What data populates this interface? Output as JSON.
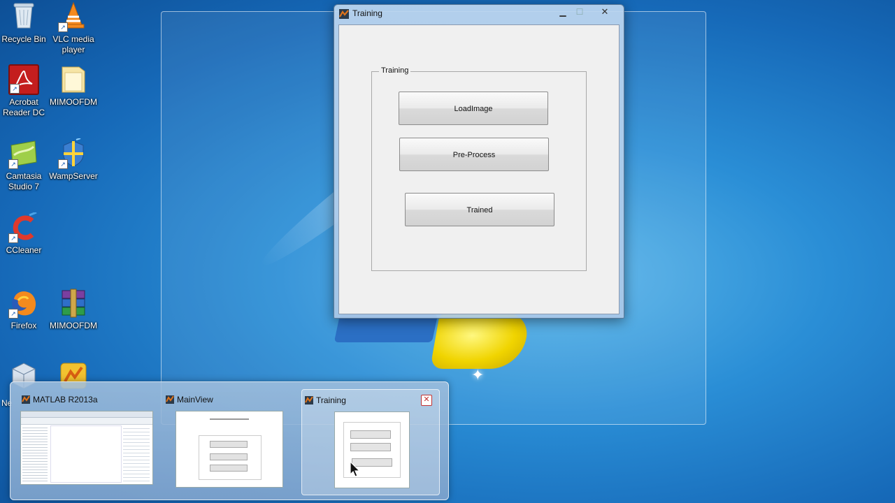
{
  "desktop": {
    "icons": [
      {
        "label": "Recycle Bin",
        "icon": "recycle-bin-icon"
      },
      {
        "label": "VLC media player",
        "icon": "vlc-icon"
      },
      {
        "label": "Acrobat Reader DC",
        "icon": "acrobat-icon"
      },
      {
        "label": "MIMOOFDM",
        "icon": "folder-icon"
      },
      {
        "label": "Camtasia Studio 7",
        "icon": "camtasia-icon"
      },
      {
        "label": "WampServer",
        "icon": "wampserver-icon"
      },
      {
        "label": "CCleaner",
        "icon": "ccleaner-icon"
      },
      {
        "label": "Firefox",
        "icon": "firefox-icon"
      },
      {
        "label": "MIMOOFDM",
        "icon": "winrar-archive-icon"
      }
    ],
    "partial_label": "Ne"
  },
  "window": {
    "title": "Training",
    "controls": {
      "minimize": "▁",
      "maximize": "☐",
      "close": "✕"
    },
    "panel": {
      "title": "Training",
      "buttons": {
        "load": "LoadImage",
        "preprocess": "Pre-Process",
        "trained": "Trained"
      }
    }
  },
  "taskbar_preview": {
    "items": [
      {
        "title": "MATLAB R2013a",
        "active": false
      },
      {
        "title": "MainView",
        "active": false
      },
      {
        "title": "Training",
        "active": true
      }
    ],
    "close_glyph": "✕"
  },
  "colors": {
    "matlab_orange": "#e0731a",
    "accent_blue": "#1669b8"
  }
}
